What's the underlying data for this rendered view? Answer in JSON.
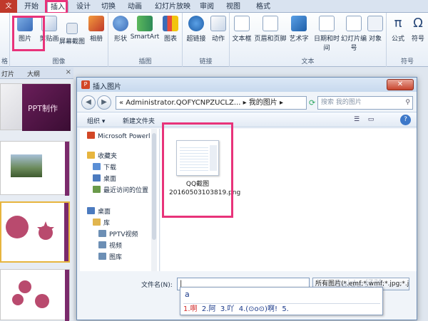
{
  "ribbon_tabs": [
    {
      "label": "文件"
    },
    {
      "label": "开始"
    },
    {
      "label": "插入"
    },
    {
      "label": "设计"
    },
    {
      "label": "切换"
    },
    {
      "label": "动画"
    },
    {
      "label": "幻灯片放映"
    },
    {
      "label": "审阅"
    },
    {
      "label": "视图"
    },
    {
      "label": "格式"
    }
  ],
  "ribbon_groups": {
    "images": {
      "label": "图像",
      "buttons": [
        "图片",
        "剪贴画",
        "屏幕截图",
        "相册"
      ]
    },
    "illustrations": {
      "label": "插图",
      "buttons": [
        "形状",
        "SmartArt",
        "图表"
      ]
    },
    "links": {
      "label": "链接",
      "buttons": [
        "超链接",
        "动作"
      ]
    },
    "text": {
      "label": "文本",
      "buttons": [
        "文本框",
        "页眉和页脚",
        "艺术字",
        "日期和时间",
        "幻灯片编号",
        "对象"
      ]
    },
    "symbols": {
      "label": "符号",
      "buttons": [
        "公式",
        "符号"
      ]
    },
    "left_partial_label": "格"
  },
  "panel": {
    "tab_slides": "灯片",
    "tab_outline": "大纲",
    "close": "×"
  },
  "slides": {
    "slide1_title": "PPT制作"
  },
  "dialog": {
    "title": "插入图片",
    "address": "« Administrator.QOFYCNPZUCLZ... ▸ 我的图片 ▸",
    "search_placeholder": "搜索 我的图片",
    "organize": "组织 ▾",
    "new_folder": "新建文件夹",
    "nav_items": [
      {
        "label": "Microsoft Powerl",
        "color": "#d24726"
      },
      {
        "label": "",
        "color": ""
      },
      {
        "label": "收藏夹",
        "color": "#e7b53e"
      },
      {
        "label": "下载",
        "color": "#5a8fd6"
      },
      {
        "label": "桌面",
        "color": "#4c7bbf"
      },
      {
        "label": "最近访问的位置",
        "color": "#6a9a4a"
      },
      {
        "label": "",
        "color": ""
      },
      {
        "label": "桌面",
        "color": "#4c7bbf"
      },
      {
        "label": "库",
        "color": "#e1b54e"
      },
      {
        "label": "PPTV视频",
        "color": "#6c8fb5"
      },
      {
        "label": "视频",
        "color": "#6c8fb5"
      },
      {
        "label": "图库",
        "color": "#6c8fb5"
      }
    ],
    "file": {
      "name": "QQ截图20160503103819.png"
    },
    "filename_label": "文件名(N):",
    "filename_value": "|",
    "filetype": "所有图片(*.emf;*.wmf;*.jpg;*.ji"
  },
  "ime": {
    "composition": "a",
    "candidates": [
      "1.啊",
      "2.阿",
      "3.吖",
      "4.(⊙o⊙)啊!",
      "5."
    ]
  },
  "watermark": "Baidu 经验"
}
